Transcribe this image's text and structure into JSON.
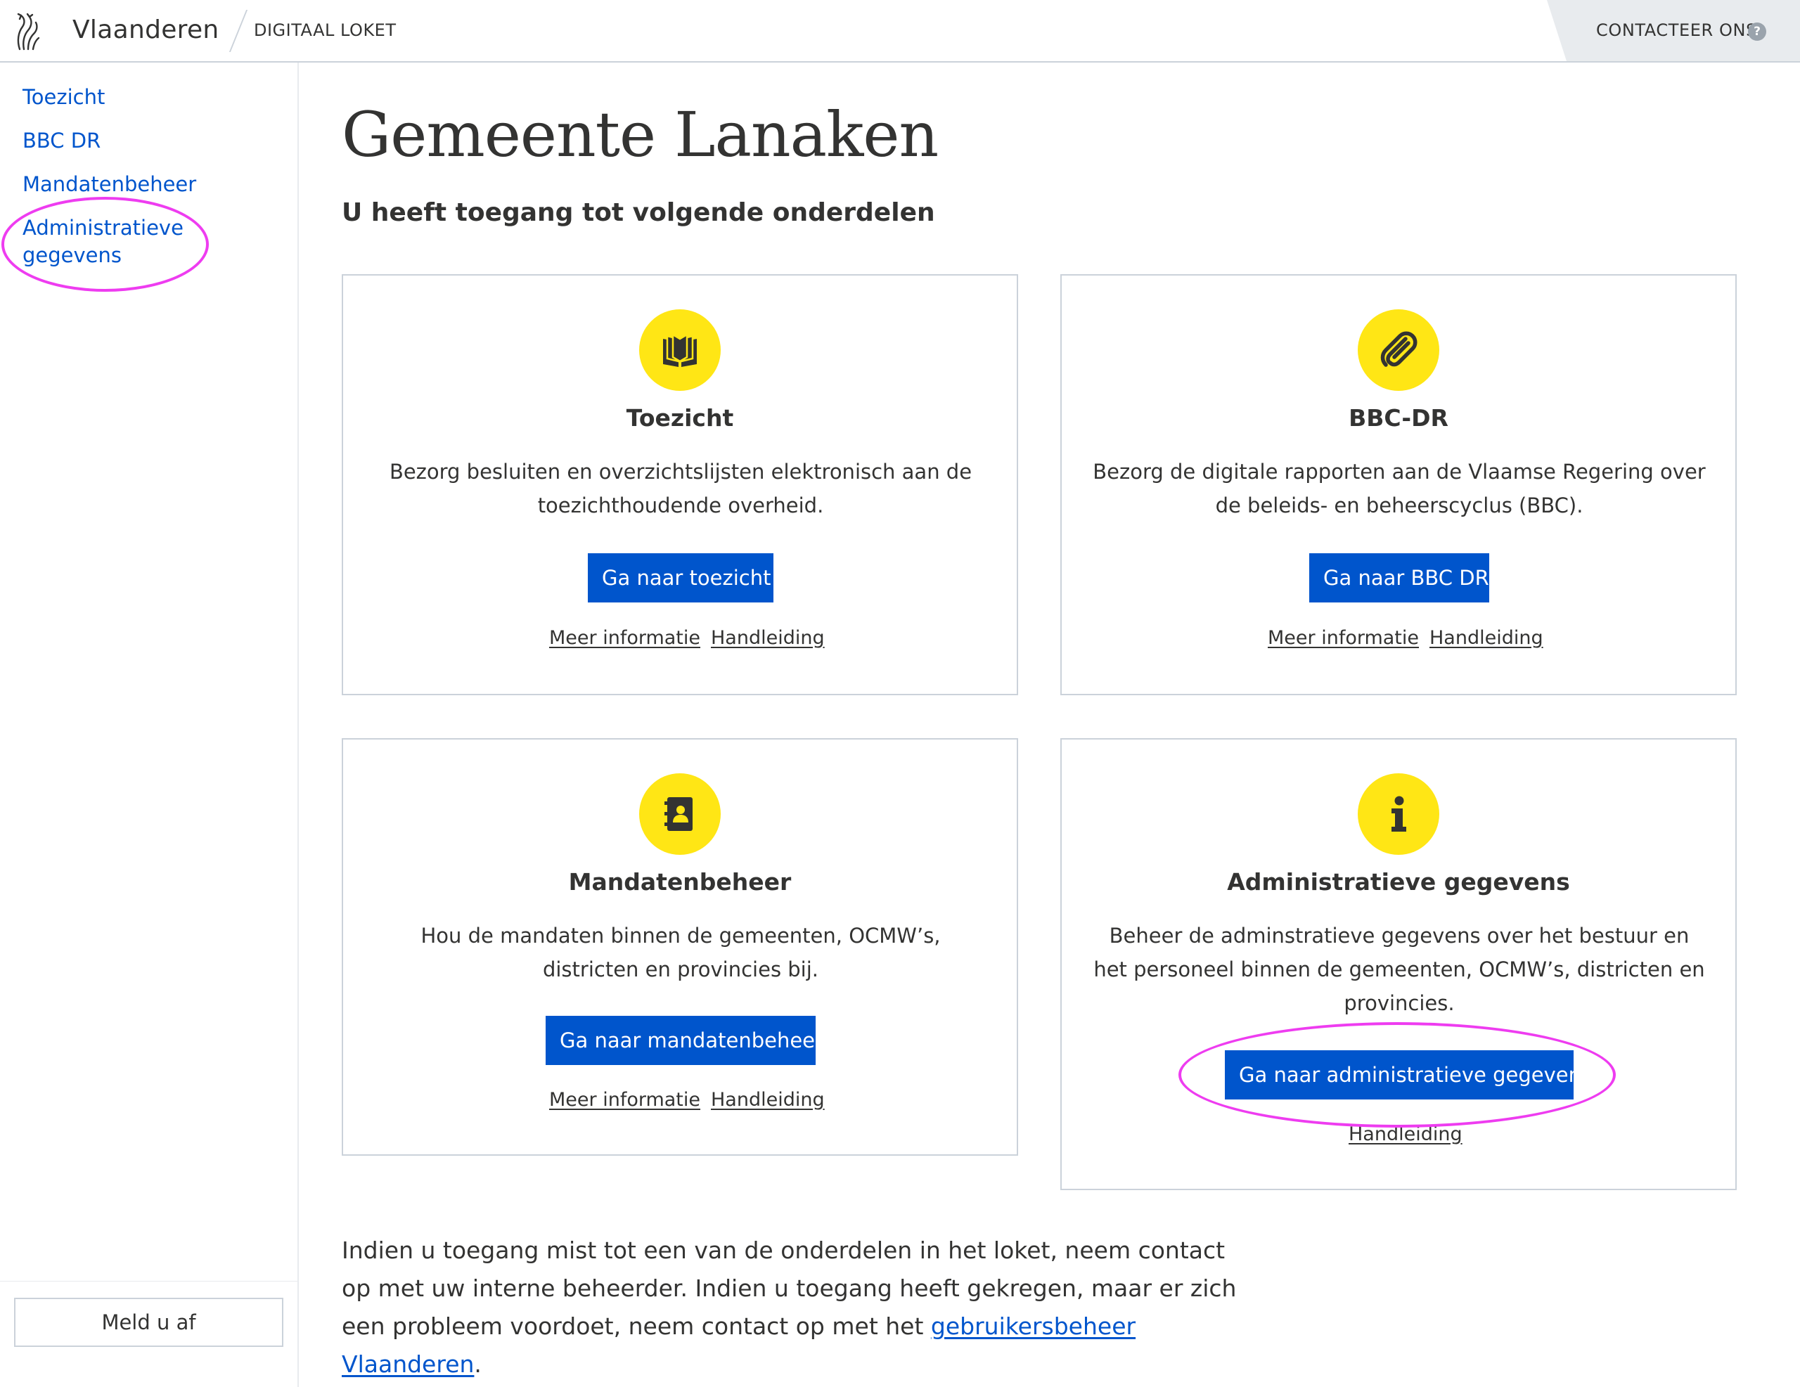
{
  "header": {
    "brand_name": "Vlaanderen",
    "product_name": "DIGITAAL LOKET",
    "contact_label": "CONTACTEER ONS",
    "help_glyph": "?"
  },
  "sidebar": {
    "items": [
      {
        "label": "Toezicht"
      },
      {
        "label": "BBC DR"
      },
      {
        "label": "Mandatenbeheer"
      },
      {
        "label": "Administratieve gegevens"
      }
    ],
    "logout_label": "Meld u af"
  },
  "main": {
    "title": "Gemeente Lanaken",
    "subtitle": "U heeft toegang tot volgende onderdelen",
    "cards": [
      {
        "icon": "book-icon",
        "title": "Toezicht",
        "description": "Bezorg besluiten en overzichtslijsten elektronisch aan de toezichthoudende overheid.",
        "button_label": "Ga naar toezicht",
        "more_info_label": "Meer informatie",
        "manual_label": "Handleiding"
      },
      {
        "icon": "paperclip-icon",
        "title": "BBC-DR",
        "description": "Bezorg de digitale rapporten aan de Vlaamse Regering over de beleids- en beheerscyclus (BBC).",
        "button_label": "Ga naar BBC DR",
        "more_info_label": "Meer informatie",
        "manual_label": "Handleiding"
      },
      {
        "icon": "address-book-icon",
        "title": "Mandatenbeheer",
        "description": "Hou de mandaten binnen de gemeenten, OCMW’s, districten en provincies bij.",
        "button_label": "Ga naar mandatenbeheer",
        "more_info_label": "Meer informatie",
        "manual_label": "Handleiding"
      },
      {
        "icon": "info-icon",
        "title": "Administratieve gegevens",
        "description": "Beheer de adminstratieve gegevens over het bestuur en het personeel binnen de gemeenten, OCMW’s, districten en provincies.",
        "button_label": "Ga naar administratieve gegevens",
        "manual_label": "Handleiding"
      }
    ],
    "footer": {
      "text_before": "Indien u toegang mist tot een van de onderdelen in het loket, neem contact op met uw interne beheerder. Indien u toegang heeft gekregen, maar er zich een probleem voordoet, neem contact op met het ",
      "link_label": "gebruikersbeheer Vlaanderen",
      "text_after": "."
    }
  },
  "colors": {
    "primary_blue": "#0055cc",
    "icon_yellow": "#ffe615",
    "annotation_magenta": "#ee3cf0",
    "border_grey": "#cbd2da",
    "text": "#333332"
  }
}
